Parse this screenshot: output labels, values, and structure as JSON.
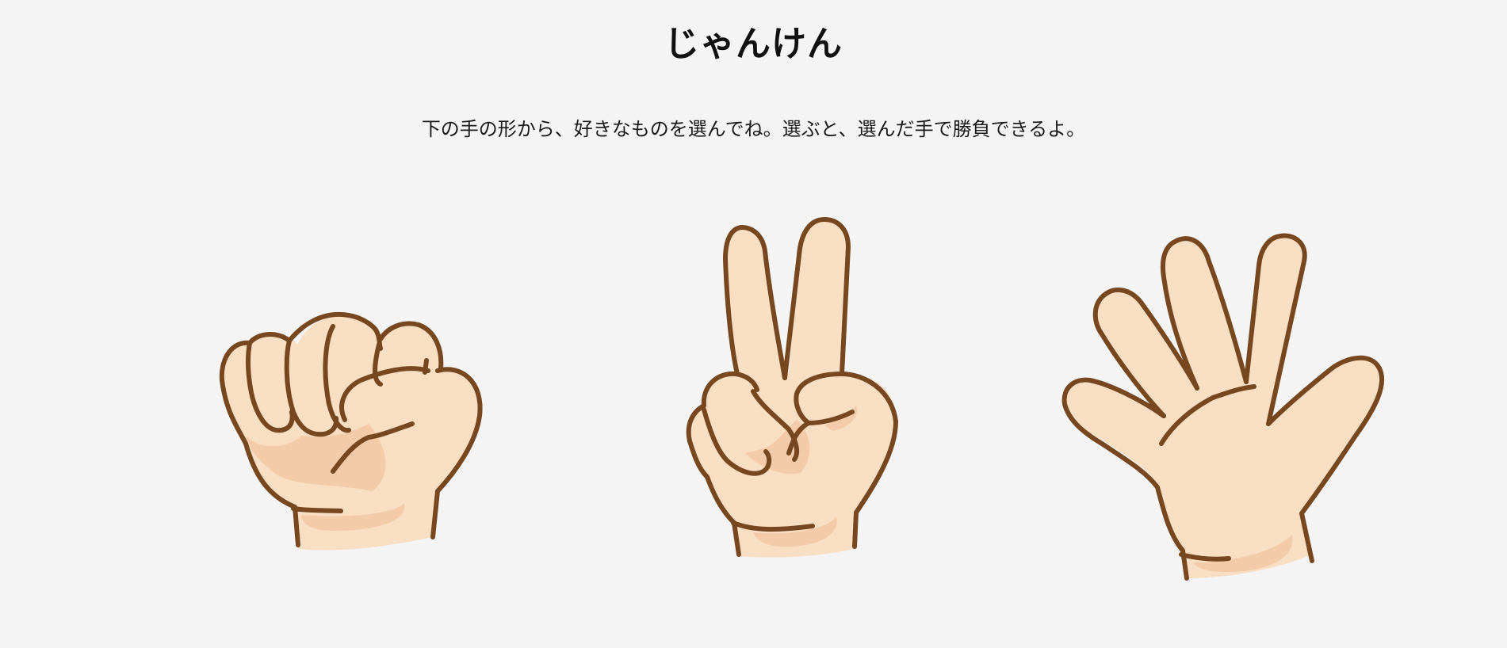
{
  "page": {
    "title": "じゃんけん",
    "instructions": "下の手の形から、好きなものを選んでね。選ぶと、選んだ手で勝負できるよ。"
  },
  "choices": [
    {
      "id": "rock",
      "icon": "rock-hand-icon"
    },
    {
      "id": "scissors",
      "icon": "scissors-hand-icon"
    },
    {
      "id": "paper",
      "icon": "paper-hand-icon"
    }
  ],
  "colors": {
    "background": "#f4f4f4",
    "skin": "#f8dfc4",
    "skin_shadow": "#f2c8a3",
    "outline": "#77471f",
    "text": "#111111"
  }
}
